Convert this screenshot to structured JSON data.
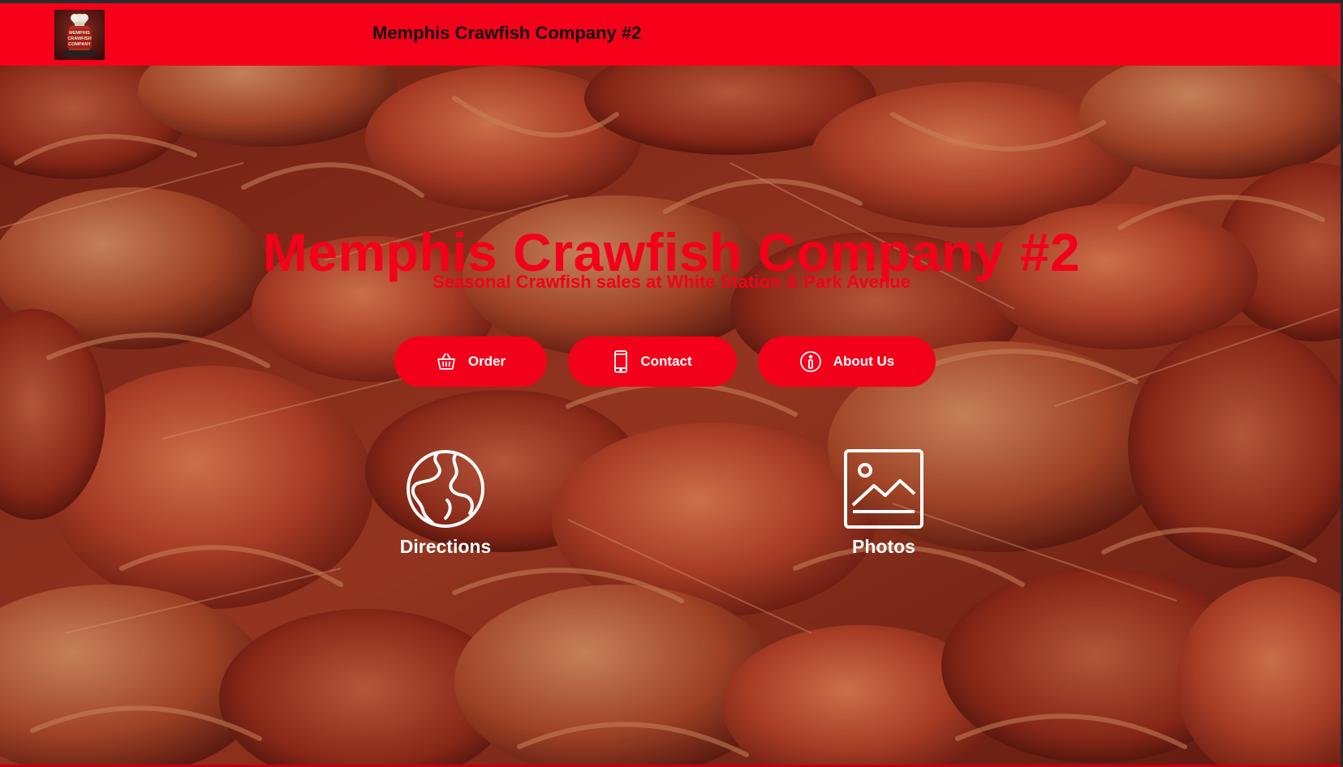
{
  "header": {
    "logo_alt": "Memphis Crawfish Company logo",
    "logo_text_line1": "MEMPHIS",
    "logo_text_line2": "CRAWFISH",
    "logo_text_line3": "COMPANY",
    "site_name": "Memphis Crawfish Company #2"
  },
  "hero": {
    "background": "crawfish-photo",
    "title": "Memphis Crawfish Company #2",
    "subtitle": "Seasonal Crawfish sales at White Station & Park Avenue"
  },
  "buttons": {
    "order": {
      "label": "Order",
      "icon": "basket-icon"
    },
    "contact": {
      "label": "Contact",
      "icon": "phone-icon"
    },
    "about": {
      "label": "About Us",
      "icon": "info-icon"
    }
  },
  "features": {
    "directions": {
      "label": "Directions",
      "icon": "globe-icon"
    },
    "photos": {
      "label": "Photos",
      "icon": "image-icon"
    }
  },
  "colors": {
    "brand_red": "#f6001a",
    "accent_red": "#f3001a",
    "text_dark": "#111111",
    "text_light": "#ffffff"
  }
}
